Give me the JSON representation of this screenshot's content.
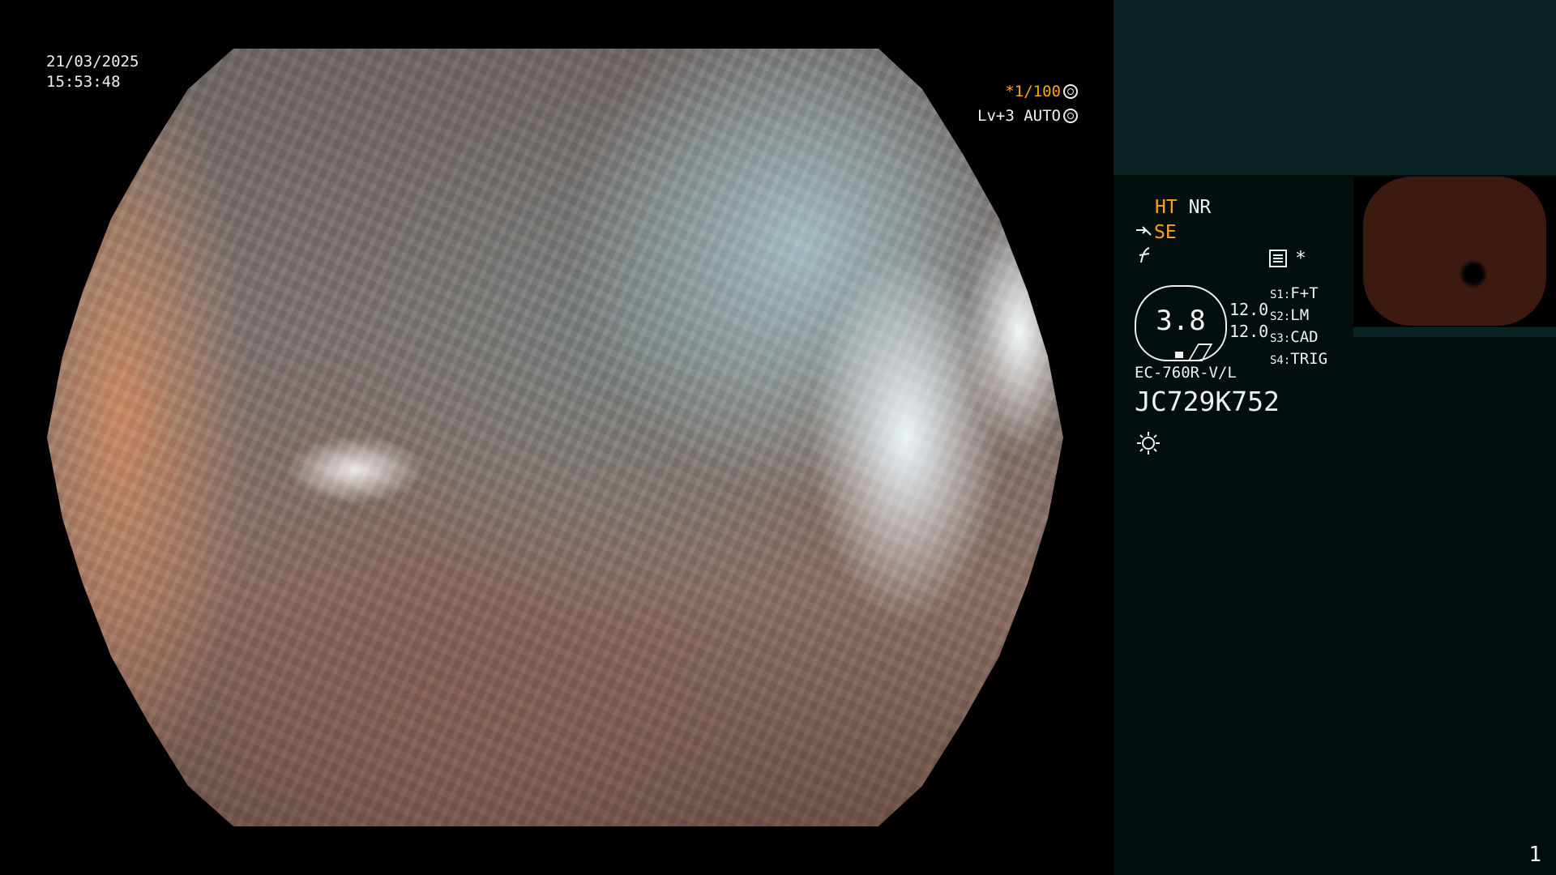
{
  "overlay": {
    "date": "21/03/2025",
    "time": "15:53:48",
    "shutter": "*1/100",
    "level_mode": "Lv+3 AUTO"
  },
  "panel": {
    "ht": "HT",
    "nr": "NR",
    "se": "SE",
    "ring_value": "3.8",
    "value_top": "12.0",
    "value_bottom": "12.0",
    "switches": [
      {
        "key": "S1:",
        "value": "F+T"
      },
      {
        "key": "S2:",
        "value": "LM"
      },
      {
        "key": "S3:",
        "value": "CAD"
      },
      {
        "key": "S4:",
        "value": "TRIG"
      }
    ],
    "scope_model": "EC-760R-V/L",
    "serial": "JC729K752",
    "asterisk": "*"
  },
  "icons": {
    "shutter_icon": "aperture-icon",
    "mode_icon": "target-icon",
    "wand_icon": "wand-icon",
    "function_icon": "f-icon",
    "memo_icon": "memo-icon",
    "light_icon": "sun-icon"
  },
  "page_number": "1",
  "colors": {
    "accent": "#ffa21a",
    "panel_bg": "#030f0f",
    "panel_top_bg": "#0b2224"
  }
}
